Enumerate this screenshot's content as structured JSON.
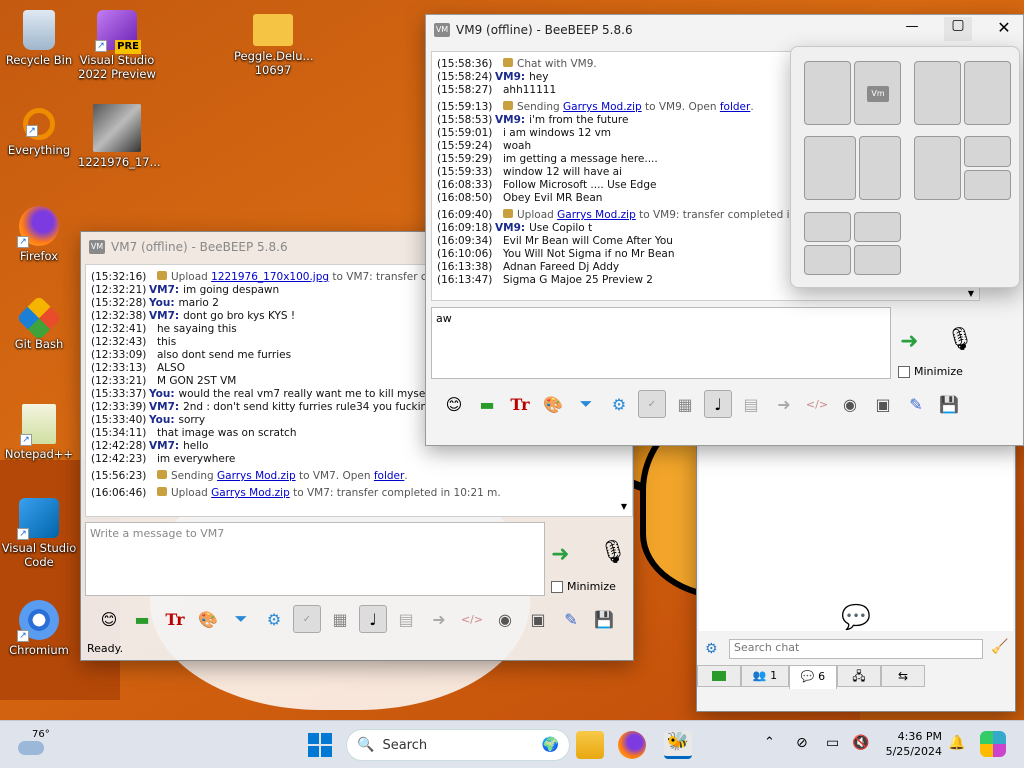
{
  "desktop": {
    "icons": [
      {
        "label": "Recycle Bin"
      },
      {
        "label": "Visual Studio 2022 Preview"
      },
      {
        "label": "Peggle.Delu... 10697"
      },
      {
        "label": "Everything"
      },
      {
        "label": "1221976_17..."
      },
      {
        "label": "Firefox"
      },
      {
        "label": "Git Bash"
      },
      {
        "label": "Notepad++"
      },
      {
        "label": "Visual Studio Code"
      },
      {
        "label": "Chromium"
      }
    ],
    "vs_badge": "PRE"
  },
  "vm7": {
    "title": "VM7 (offline) - BeeBEEP 5.8.6",
    "logo": "VM",
    "input_placeholder": "Write a message to VM7",
    "minimize_label": "Minimize",
    "status": "Ready.",
    "log": [
      {
        "ts": "(15:32:16)",
        "type": "file",
        "parts": [
          "Upload ",
          "1221976_170x100.jpg",
          " to VM7: transfer comple"
        ]
      },
      {
        "ts": "(12:32:21)",
        "who": "VM7:",
        "text": "im going despawn"
      },
      {
        "ts": "(15:32:28)",
        "who": "You:",
        "text": "mario 2"
      },
      {
        "ts": "(12:32:38)",
        "who": "VM7:",
        "text": "dont   go bro kys KYS !"
      },
      {
        "ts": "(12:32:41)",
        "text": "he sayaing this"
      },
      {
        "ts": "(12:32:43)",
        "text": "this"
      },
      {
        "ts": "(12:33:09)",
        "text": "also dont send me furries"
      },
      {
        "ts": "(12:33:13)",
        "text": "ALSO"
      },
      {
        "ts": "(12:33:21)",
        "text": "M GON 2ST VM"
      },
      {
        "ts": "(15:33:37)",
        "who": "You:",
        "text": "would the real vm7 really want me to kill myself"
      },
      {
        "ts": "(12:33:39)",
        "who": "VM7:",
        "text": "2nd : don't send kitty furries rule34 you fucking dumi"
      },
      {
        "ts": "(15:33:40)",
        "who": "You:",
        "text": "sorry"
      },
      {
        "ts": "(15:34:11)",
        "text": "that image was on scratch"
      },
      {
        "ts": "(12:42:28)",
        "who": "VM7:",
        "text": "hello"
      },
      {
        "ts": "(12:42:23)",
        "text": "im everywhere"
      },
      {
        "ts": "(15:56:23)",
        "type": "file",
        "parts": [
          "Sending ",
          "Garrys Mod.zip",
          " to VM7. Open ",
          "folder",
          "."
        ]
      },
      {
        "ts": "(16:06:46)",
        "type": "file",
        "parts": [
          "Upload ",
          "Garrys Mod.zip",
          " to VM7: transfer completed in 10:21 m."
        ]
      }
    ]
  },
  "vm9": {
    "title": "VM9 (offline) - BeeBEEP 5.8.6",
    "logo": "VM",
    "input_value": "aw",
    "minimize_label": "Minimize",
    "log": [
      {
        "ts": "(15:58:36)",
        "type": "file",
        "parts": [
          "Chat with VM9."
        ]
      },
      {
        "ts": "(15:58:24)",
        "who": "VM9:",
        "text": "hey"
      },
      {
        "ts": "(15:58:27)",
        "text": "ahh11111"
      },
      {
        "ts": "(15:59:13)",
        "type": "file",
        "parts": [
          "Sending ",
          "Garrys Mod.zip",
          " to VM9. Open ",
          "folder",
          "."
        ]
      },
      {
        "ts": "(15:58:53)",
        "who": "VM9:",
        "text": "i'm from the future"
      },
      {
        "ts": "(15:59:01)",
        "text": "i am windows 12 vm"
      },
      {
        "ts": "(15:59:24)",
        "text": "woah"
      },
      {
        "ts": "(15:59:29)",
        "text": "im getting a message here...."
      },
      {
        "ts": "(15:59:33)",
        "text": "window 12 will have ai"
      },
      {
        "ts": "(16:08:33)",
        "text": "Follow Microsoft .... Use Edge"
      },
      {
        "ts": "(16:08:50)",
        "text": "Obey Evil MR Bean"
      },
      {
        "ts": "(16:09:40)",
        "type": "file",
        "parts": [
          "Upload ",
          "Garrys Mod.zip",
          " to VM9: transfer completed in 10:25"
        ]
      },
      {
        "ts": "(16:09:18)",
        "who": "VM9:",
        "text": "Use Copilo t"
      },
      {
        "ts": "(16:09:34)",
        "text": "Evil Mr Bean will Come After You"
      },
      {
        "ts": "(16:10:06)",
        "text": "You Will Not Sigma if no Mr Bean"
      },
      {
        "ts": "(16:13:38)",
        "text": "Adnan Fareed Dj Addy"
      },
      {
        "ts": "(16:13:47)",
        "text": "Sigma G Majoe 25 Preview 2"
      }
    ]
  },
  "snap": {
    "vm_tile": "Vm"
  },
  "main_panel": {
    "search_placeholder": "Search chat",
    "tabs": [
      {
        "count": ""
      },
      {
        "count": "1"
      },
      {
        "count": "6"
      },
      {
        "count": ""
      },
      {
        "count": ""
      }
    ]
  },
  "taskbar": {
    "weather_temp": "76°",
    "search_label": "Search",
    "time": "4:36 PM",
    "date": "5/25/2024"
  },
  "colors": {
    "accent": "#0067c0",
    "link": "#0000cc",
    "sender": "#1a2a8a"
  }
}
